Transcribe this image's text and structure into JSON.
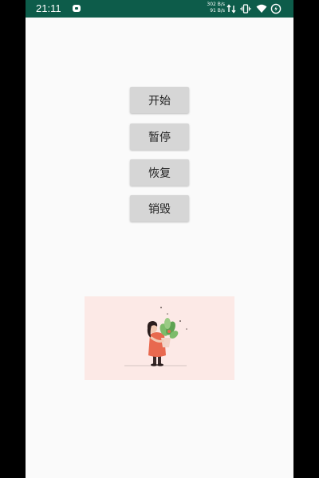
{
  "status_bar": {
    "time": "21:11",
    "net_speed_top": "302 B/s",
    "net_speed_bottom": "91 B/s",
    "icons": [
      "notification-app-icon",
      "data-transfer-icon",
      "vibrate-icon",
      "wifi-icon",
      "battery-icon"
    ],
    "background_color": "#0d5c4a"
  },
  "buttons": {
    "start": "开始",
    "pause": "暂停",
    "resume": "恢复",
    "destroy": "销毁"
  },
  "illustration": {
    "description_icon": "girl-holding-plant-illustration",
    "background_color": "#fce9e6"
  }
}
